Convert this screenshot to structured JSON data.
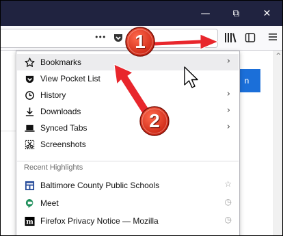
{
  "window": {
    "minimize_glyph": "—",
    "restore_glyph": "⧉",
    "close_glyph": "✕"
  },
  "toolbar": {
    "more_glyph": "•••",
    "library_icon": "library-icon",
    "sidebar_icon": "sidebar-icon",
    "menu_icon": "hamburger-menu-icon"
  },
  "page": {
    "button_fragment": "n"
  },
  "library_menu": {
    "items": [
      {
        "icon": "star-icon",
        "glyph": "☆",
        "label": "Bookmarks",
        "arrow": "›"
      },
      {
        "icon": "pocket-icon",
        "glyph": "♥",
        "label": "View Pocket List",
        "arrow": ""
      },
      {
        "icon": "clock-icon",
        "glyph": "◷",
        "label": "History",
        "arrow": "›"
      },
      {
        "icon": "download-icon",
        "glyph": "⤓",
        "label": "Downloads",
        "arrow": "›"
      },
      {
        "icon": "synced-tabs-icon",
        "glyph": "▬",
        "label": "Synced Tabs",
        "arrow": "›"
      },
      {
        "icon": "screenshot-icon",
        "glyph": "✂",
        "label": "Screenshots",
        "arrow": ""
      }
    ],
    "recent_header": "Recent Highlights",
    "recent": [
      {
        "icon": "bcps-favicon",
        "glyph": "▤",
        "label": "Baltimore County Public Schools",
        "right_icon": "star-outline-icon",
        "right_glyph": "☆"
      },
      {
        "icon": "meet-favicon",
        "glyph": "●",
        "label": "Meet",
        "right_icon": "clock-icon",
        "right_glyph": "◷"
      },
      {
        "icon": "mdn-favicon",
        "glyph": "m",
        "label": "Firefox Privacy Notice — Mozilla",
        "right_icon": "clock-icon",
        "right_glyph": "◷"
      }
    ]
  },
  "annotations": {
    "badge_1": "1",
    "badge_2": "2",
    "badge_color": "#e0341e",
    "arrow_color": "#e8262c"
  },
  "colors": {
    "titlebar": "#202340",
    "toolbar": "#f9f9fb",
    "accent_blue": "#1b6fd9"
  }
}
